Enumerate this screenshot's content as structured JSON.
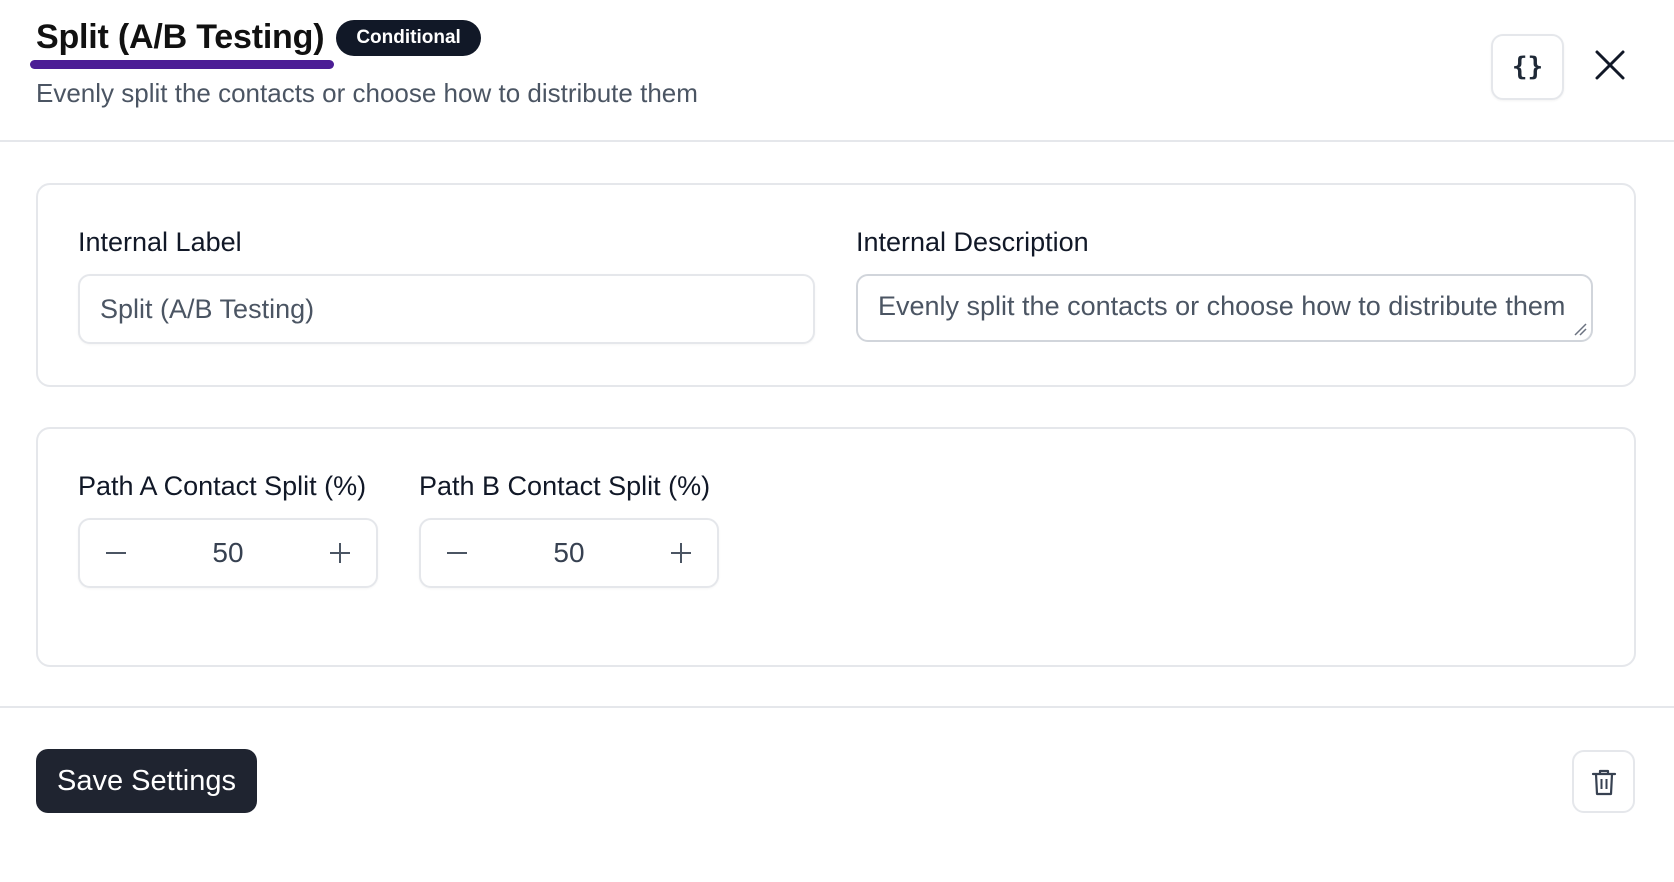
{
  "header": {
    "title": "Split (A/B Testing)",
    "badge": "Conditional",
    "subtitle": "Evenly split the contacts or choose how to distribute them",
    "json_button_label": "{}",
    "accent_color": "#4c1d95"
  },
  "form": {
    "internal_label": {
      "label": "Internal Label",
      "value": "Split (A/B Testing)"
    },
    "internal_description": {
      "label": "Internal Description",
      "value": "Evenly split the contacts or choose how to distribute them"
    }
  },
  "split": {
    "path_a": {
      "label": "Path A Contact Split (%)",
      "value": "50"
    },
    "path_b": {
      "label": "Path B Contact Split (%)",
      "value": "50"
    }
  },
  "footer": {
    "save_label": "Save Settings",
    "save_color": "#1f2430"
  },
  "icons": {
    "json": "curly-braces-icon",
    "close": "close-icon",
    "minus": "minus-icon",
    "plus": "plus-icon",
    "delete": "trash-icon"
  }
}
